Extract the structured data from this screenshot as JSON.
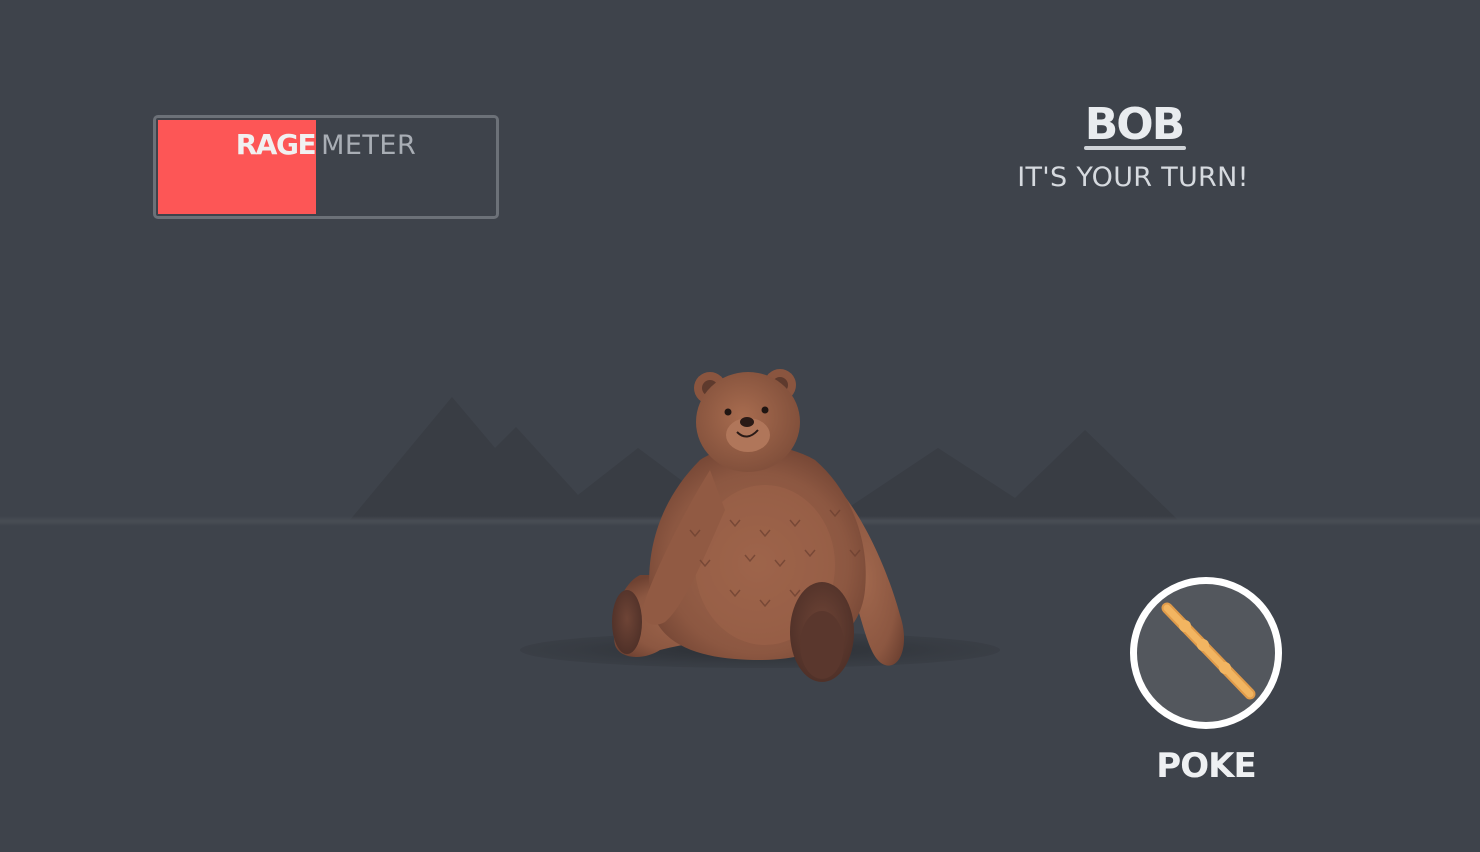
{
  "rage_meter": {
    "rage_word": "RAGE",
    "meter_word": "METER",
    "level_fraction": 0.47,
    "fill_color": "#fd5656"
  },
  "player": {
    "name": "BOB",
    "turn_text": "IT'S YOUR TURN!"
  },
  "action": {
    "label": "POKE",
    "icon": "stick-icon"
  },
  "colors": {
    "background": "#3e434b",
    "mountains": "#383c43",
    "button_fill": "#53575d",
    "stick": "#f2b561"
  }
}
